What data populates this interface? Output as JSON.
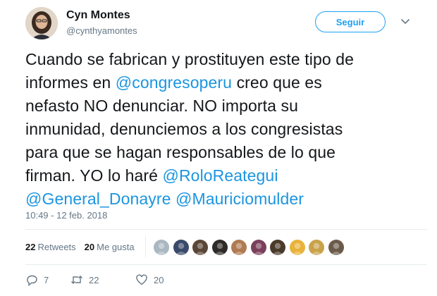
{
  "author": {
    "name": "Cyn Montes",
    "handle": "@cynthyamontes"
  },
  "follow_button": "Seguir",
  "tweet": {
    "lines": [
      [
        {
          "t": "Cuando se fabrican y prostituyen este tipo de",
          "m": false
        }
      ],
      [
        {
          "t": "informes en ",
          "m": false
        },
        {
          "t": "@congresoperu",
          "m": true
        },
        {
          "t": " creo que es",
          "m": false
        }
      ],
      [
        {
          "t": "nefasto NO denunciar. NO importa su",
          "m": false
        }
      ],
      [
        {
          "t": "inmunidad, denunciemos a los congresistas",
          "m": false
        }
      ],
      [
        {
          "t": "para que se hagan responsables de lo que",
          "m": false
        }
      ],
      [
        {
          "t": "firman. YO lo haré ",
          "m": false
        },
        {
          "t": "@RoloReategui",
          "m": true
        }
      ],
      [
        {
          "t": "@General_Donayre",
          "m": true
        },
        {
          "t": " ",
          "m": false
        },
        {
          "t": "@Mauriciomulder",
          "m": true
        }
      ]
    ]
  },
  "timestamp": "10:49 - 12 feb. 2018",
  "stats": {
    "retweets_count": "22",
    "retweets_label": "Retweets",
    "likes_count": "20",
    "likes_label": "Me gusta"
  },
  "liker_colors": [
    "#aab8c2",
    "#3a4a6b",
    "#5a4636",
    "#2e2a28",
    "#b07a52",
    "#7a3f5a",
    "#4a3a2a",
    "#e8b33a",
    "#c9a24a",
    "#6b5a4a"
  ],
  "actions": {
    "replies": "7",
    "retweets": "22",
    "likes": "20"
  },
  "colors": {
    "accent": "#1da1f2",
    "mention": "#1b95e0",
    "muted": "#657786"
  }
}
